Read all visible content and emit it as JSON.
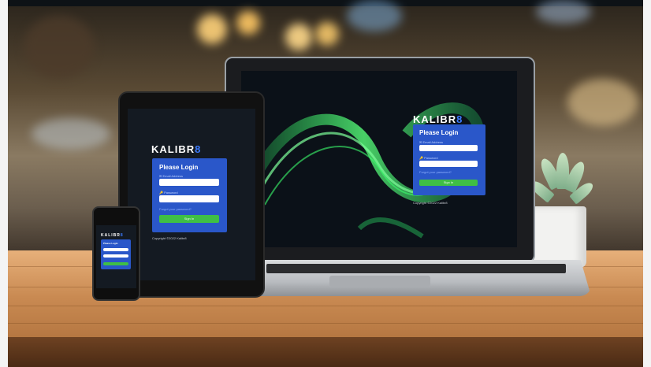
{
  "brand": {
    "name": "KALIBR",
    "mark": "8"
  },
  "login": {
    "title": "Please Login",
    "email_label": "✉ Email Address",
    "password_label": "🔑 Password",
    "forgot": "Forgot your password?",
    "signin": "Sign In"
  },
  "footer": {
    "copyright": "Copyright ©2022 Kalibr8"
  },
  "colors": {
    "card": "#2a57c9",
    "button": "#3fbf45",
    "screen_bg": "#0b1118",
    "accent": "#3c7bff"
  },
  "icons": {
    "email": "envelope-icon",
    "password": "key-icon"
  }
}
